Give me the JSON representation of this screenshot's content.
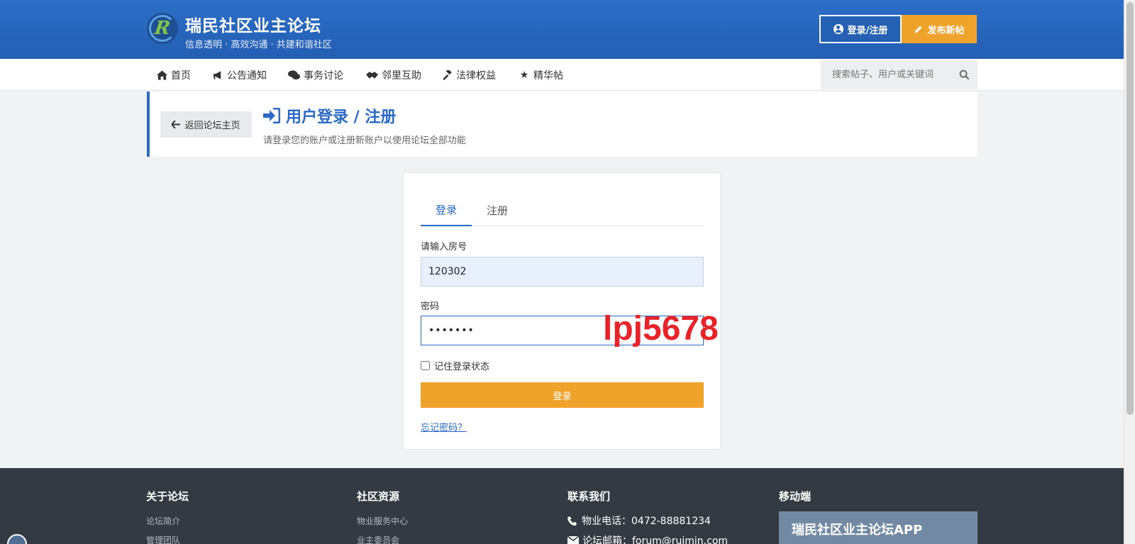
{
  "header": {
    "site_title": "瑞民社区业主论坛",
    "site_subtitle": "信息透明 · 高效沟通 · 共建和谐社区",
    "login_button": "登录/注册",
    "post_button": "发布新帖"
  },
  "nav": {
    "items": [
      {
        "label": "首页",
        "icon": "home-icon"
      },
      {
        "label": "公告通知",
        "icon": "megaphone-icon"
      },
      {
        "label": "事务讨论",
        "icon": "comments-icon"
      },
      {
        "label": "邻里互助",
        "icon": "handshake-icon"
      },
      {
        "label": "法律权益",
        "icon": "gavel-icon"
      },
      {
        "label": "精华帖",
        "icon": "star-icon"
      }
    ],
    "search_placeholder": "搜索帖子、用户或关键词"
  },
  "page_header": {
    "back_button": "返回论坛主页",
    "title": "用户登录 / 注册",
    "subtitle": "请登录您的账户或注册新账户以使用论坛全部功能"
  },
  "login": {
    "tabs": [
      "登录",
      "注册"
    ],
    "active_tab": "登录",
    "room_label": "请输入房号",
    "room_value": "120302",
    "password_label": "密码",
    "password_value": "•••••••",
    "remember_label": "记住登录状态",
    "remember_checked": false,
    "submit_label": "登录",
    "forgot_link": "忘记密码？"
  },
  "overlay_text": "lpj5678",
  "footer": {
    "about": {
      "title": "关于论坛",
      "links": [
        "论坛简介",
        "管理团队"
      ]
    },
    "resources": {
      "title": "社区资源",
      "links": [
        "物业服务中心",
        "业主委员会"
      ]
    },
    "contact": {
      "title": "联系我们",
      "phone": "物业电话：0472-88881234",
      "email": "论坛邮箱：forum@ruimin.com"
    },
    "mobile": {
      "title": "移动端",
      "app_name": "瑞民社区业主论坛APP"
    }
  },
  "colors": {
    "brand_blue": "#2a6ac8",
    "accent_orange": "#f0a32b",
    "footer_bg": "#343a41",
    "overlay_red": "#e8242b"
  }
}
